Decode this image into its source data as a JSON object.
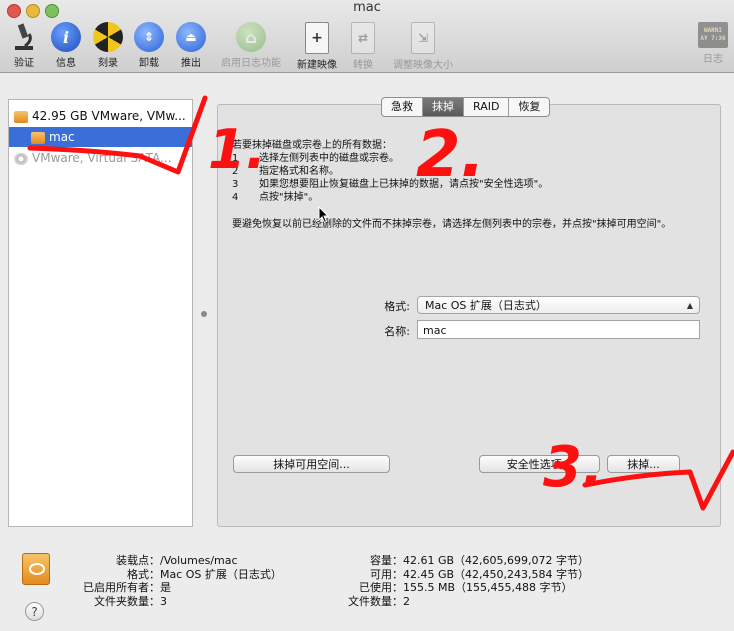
{
  "window": {
    "title": "mac"
  },
  "toolbar": {
    "items": [
      {
        "label": "验证",
        "icon": "microscope-icon"
      },
      {
        "label": "信息",
        "icon": "info-icon"
      },
      {
        "label": "刻录",
        "icon": "burn-icon"
      },
      {
        "label": "卸载",
        "icon": "unmount-icon"
      },
      {
        "label": "推出",
        "icon": "eject-icon"
      },
      {
        "label": "启用日志功能",
        "icon": "journal-icon"
      },
      {
        "label": "新建映像",
        "icon": "new-image-icon"
      },
      {
        "label": "转换",
        "icon": "convert-icon"
      },
      {
        "label": "调整映像大小",
        "icon": "resize-image-icon"
      },
      {
        "label": "日志",
        "icon": "log-icon"
      }
    ],
    "log_badge": "WARNI\nAY 7:36"
  },
  "sidebar": {
    "items": [
      {
        "label": "42.95 GB VMware, VMw..."
      },
      {
        "label": "mac"
      },
      {
        "label": "VMware, Virtual SATA..."
      }
    ]
  },
  "tabs": [
    "急救",
    "抹掉",
    "RAID",
    "恢复"
  ],
  "erase": {
    "heading": "若要抹掉磁盘或宗卷上的所有数据：",
    "steps": [
      {
        "n": "1",
        "text": "选择左侧列表中的磁盘或宗卷。"
      },
      {
        "n": "2",
        "text": "指定格式和名称。"
      },
      {
        "n": "3",
        "text": "如果您想要阻止恢复磁盘上已抹掉的数据，请点按\"安全性选项\"。"
      },
      {
        "n": "4",
        "text": "点按\"抹掉\"。"
      }
    ],
    "note": "要避免恢复以前已经删除的文件而不抹掉宗卷，请选择左侧列表中的宗卷，并点按\"抹掉可用空间\"。",
    "format_label": "格式:",
    "format_value": "Mac OS 扩展（日志式）",
    "name_label": "名称:",
    "name_value": "mac",
    "erase_free_space_button": "抹掉可用空间...",
    "security_options_button": "安全性选项...",
    "erase_button": "抹掉..."
  },
  "info": {
    "left": [
      {
        "k": "装载点：",
        "v": "/Volumes/mac"
      },
      {
        "k": "格式：",
        "v": "Mac OS 扩展（日志式）"
      },
      {
        "k": "已启用所有者：",
        "v": "是"
      },
      {
        "k": "文件夹数量：",
        "v": "3"
      }
    ],
    "right": [
      {
        "k": "容量：",
        "v": "42.61 GB（42,605,699,072 字节）"
      },
      {
        "k": "可用：",
        "v": "42.45 GB（42,450,243,584 字节）"
      },
      {
        "k": "已使用：",
        "v": "155.5 MB（155,455,488 字节）"
      },
      {
        "k": "文件数量：",
        "v": "2"
      }
    ]
  },
  "annotations": {
    "mark1": "1.",
    "mark2": "2.",
    "mark3": "3."
  },
  "colors": {
    "selection": "#3a6fd8",
    "annotation": "#ff1010"
  }
}
